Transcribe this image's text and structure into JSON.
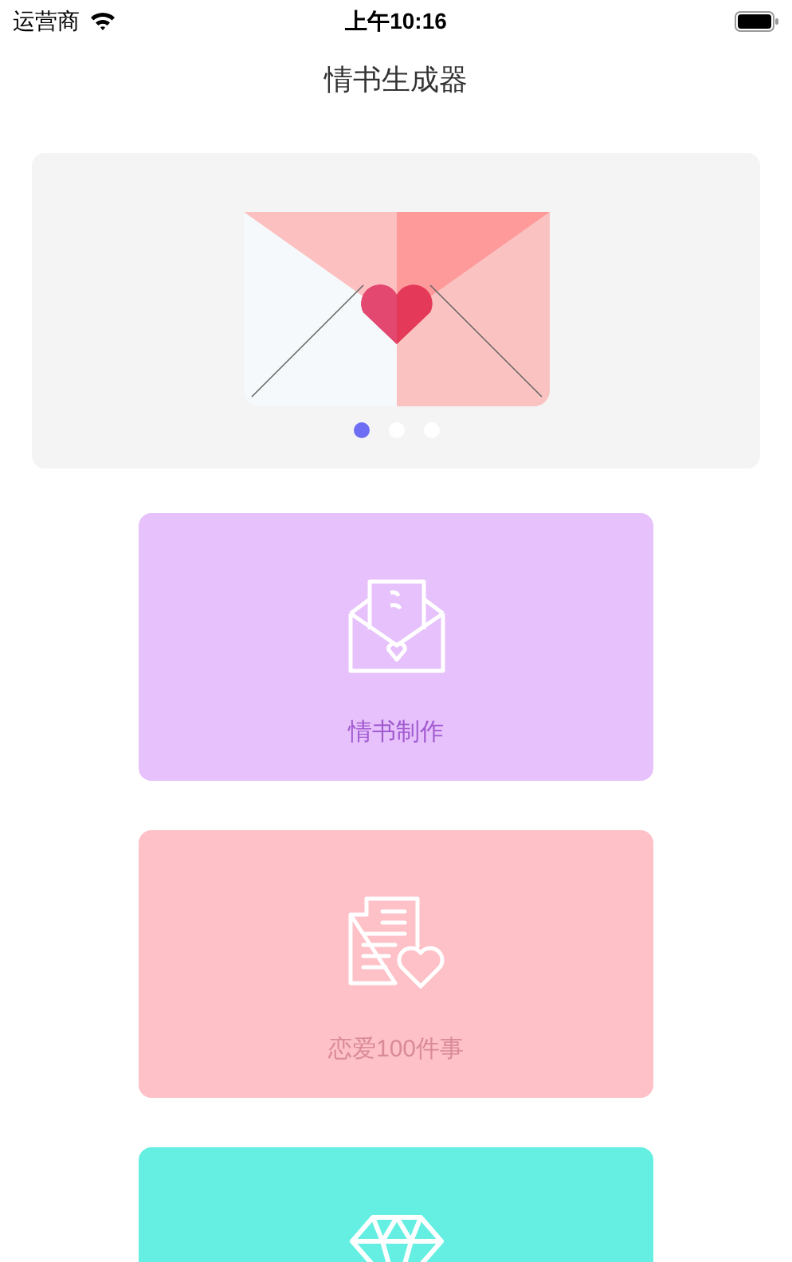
{
  "status_bar": {
    "carrier": "运营商",
    "time": "上午10:16"
  },
  "nav": {
    "title": "情书生成器"
  },
  "banner": {
    "dots": [
      {
        "selected": true
      },
      {
        "selected": false
      },
      {
        "selected": false
      }
    ]
  },
  "cards": [
    {
      "kind": "letter",
      "label": "情书制作",
      "color": "#e6c1fb"
    },
    {
      "kind": "document",
      "label": "恋爱100件事",
      "color": "#fdc1c7"
    },
    {
      "kind": "diamond",
      "color": "#65efe2"
    }
  ]
}
